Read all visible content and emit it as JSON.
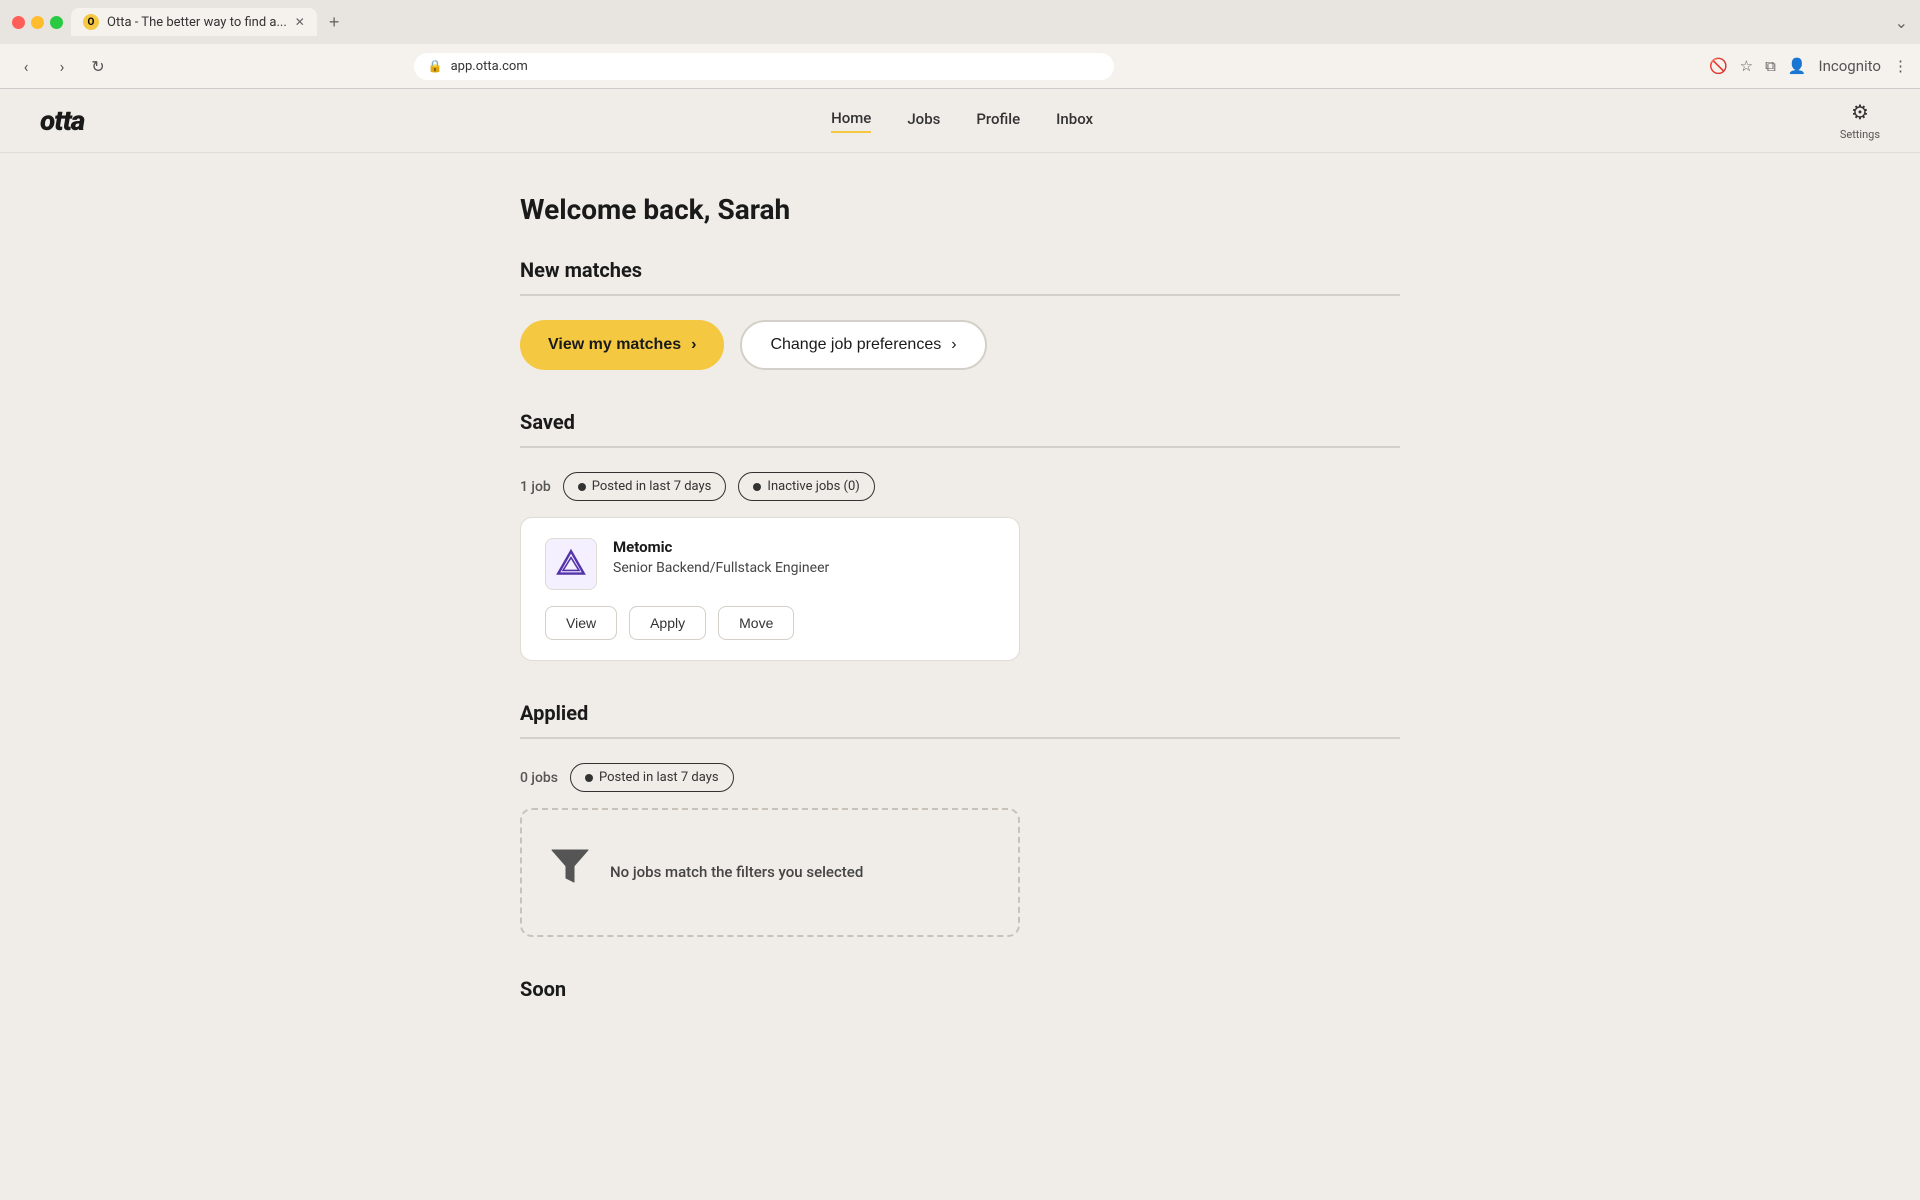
{
  "browser": {
    "tab_favicon": "O",
    "tab_title": "Otta - The better way to find a...",
    "tab_close": "✕",
    "new_tab": "+",
    "nav_back": "‹",
    "nav_forward": "›",
    "nav_refresh": "↻",
    "address": "app.otta.com",
    "incognito_label": "Incognito",
    "overflow_icon": "⋮"
  },
  "navbar": {
    "logo": "otta",
    "links": [
      {
        "label": "Home",
        "active": true
      },
      {
        "label": "Jobs",
        "active": false
      },
      {
        "label": "Profile",
        "active": false
      },
      {
        "label": "Inbox",
        "active": false
      }
    ],
    "settings_label": "Settings"
  },
  "page": {
    "welcome": "Welcome back, Sarah",
    "new_matches_title": "New matches",
    "view_matches_btn": "View my matches",
    "change_prefs_btn": "Change job preferences",
    "saved_title": "Saved",
    "saved_jobs_count": "1 job",
    "saved_filter_1": "Posted in last 7 days",
    "saved_filter_2": "Inactive jobs (0)",
    "job_company": "Metomic",
    "job_title": "Senior Backend/Fullstack Engineer",
    "view_btn": "View",
    "apply_btn": "Apply",
    "move_btn": "Move",
    "applied_title": "Applied",
    "applied_jobs_count": "0 jobs",
    "applied_filter": "Posted in last 7 days",
    "empty_state_text": "No jobs match the filters you selected",
    "soon_title": "Soon"
  },
  "colors": {
    "accent_yellow": "#f5c842",
    "bg": "#f0ede8",
    "card_bg": "#ffffff",
    "border": "#e0dbd4",
    "text_dark": "#1a1a1a",
    "text_mid": "#444444",
    "text_muted": "#777777"
  }
}
